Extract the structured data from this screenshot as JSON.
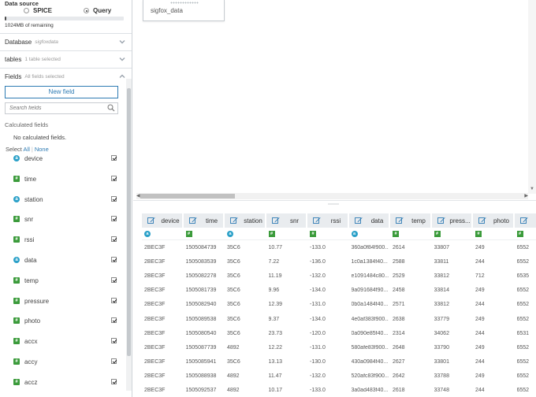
{
  "data_source": {
    "title": "Data source",
    "options": [
      {
        "label": "SPICE",
        "selected": false
      },
      {
        "label": "Query",
        "selected": true
      }
    ],
    "spice_used_fraction": 0.01,
    "remaining_text": "1024MB of remaining"
  },
  "database": {
    "label": "Database",
    "value": "sigfoxdata"
  },
  "tables": {
    "label": "tables",
    "value": "1 table selected"
  },
  "fields": {
    "label": "Fields",
    "value": "All fields selected",
    "new_field_label": "New field",
    "search_placeholder": "Search fields",
    "calculated_title": "Calculated fields",
    "no_calculated": "No calculated fields.",
    "select_label": "Select",
    "select_all": "All",
    "select_none": "None",
    "items": [
      {
        "name": "device",
        "type": "string",
        "icon": "a",
        "checked": true
      },
      {
        "name": "time",
        "type": "integer",
        "icon": "#",
        "checked": true
      },
      {
        "name": "station",
        "type": "string",
        "icon": "a",
        "checked": true
      },
      {
        "name": "snr",
        "type": "decimal",
        "icon": "#",
        "checked": true
      },
      {
        "name": "rssi",
        "type": "decimal",
        "icon": "#",
        "checked": true
      },
      {
        "name": "data",
        "type": "string",
        "icon": "a",
        "checked": true
      },
      {
        "name": "temp",
        "type": "integer",
        "icon": "#",
        "checked": true
      },
      {
        "name": "pressure",
        "type": "integer",
        "icon": "#",
        "checked": true
      },
      {
        "name": "photo",
        "type": "integer",
        "icon": "#",
        "checked": true
      },
      {
        "name": "accx",
        "type": "integer",
        "icon": "#",
        "checked": true
      },
      {
        "name": "accy",
        "type": "integer",
        "icon": "#",
        "checked": true
      },
      {
        "name": "accz",
        "type": "integer",
        "icon": "#",
        "checked": true
      }
    ]
  },
  "canvas": {
    "table_name": "sigfox_data"
  },
  "preview": {
    "columns": [
      {
        "name": "device",
        "type": "string",
        "icon": "a"
      },
      {
        "name": "time",
        "type": "integer",
        "icon": "#"
      },
      {
        "name": "station",
        "type": "string",
        "icon": "a"
      },
      {
        "name": "snr",
        "type": "decimal",
        "icon": "#"
      },
      {
        "name": "rssi",
        "type": "decimal",
        "icon": "#"
      },
      {
        "name": "data",
        "type": "string",
        "icon": "a"
      },
      {
        "name": "temp",
        "type": "integer",
        "icon": "#"
      },
      {
        "name": "press...",
        "type": "integer",
        "icon": "#"
      },
      {
        "name": "photo",
        "type": "integer",
        "icon": "#"
      },
      {
        "name": "",
        "type": "integer",
        "icon": "#"
      }
    ],
    "rows": [
      [
        "2BEC3F",
        "1505084739",
        "35C6",
        "10.77",
        "-133.0",
        "360a0f84f900...",
        "2614",
        "33807",
        "249",
        "6552"
      ],
      [
        "2BEC3F",
        "1505083539",
        "35C6",
        "7.22",
        "-136.0",
        "1c0a1384f40...",
        "2588",
        "33811",
        "244",
        "6552"
      ],
      [
        "2BEC3F",
        "1505082278",
        "35C6",
        "11.19",
        "-132.0",
        "e1091484c80...",
        "2529",
        "33812",
        "712",
        "6535"
      ],
      [
        "2BEC3F",
        "1505081739",
        "35C6",
        "9.96",
        "-134.0",
        "9a091684f90...",
        "2458",
        "33814",
        "249",
        "6552"
      ],
      [
        "2BEC3F",
        "1505082940",
        "35C6",
        "12.39",
        "-131.0",
        "0b0a1484f40...",
        "2571",
        "33812",
        "244",
        "6552"
      ],
      [
        "2BEC3F",
        "1505089538",
        "35C6",
        "9.37",
        "-134.0",
        "4e0af383f900...",
        "2638",
        "33779",
        "249",
        "6552"
      ],
      [
        "2BEC3F",
        "1505080540",
        "35C6",
        "23.73",
        "-120.0",
        "0a090e85f40...",
        "2314",
        "34062",
        "244",
        "6531"
      ],
      [
        "2BEC3F",
        "1505087739",
        "4892",
        "12.22",
        "-131.0",
        "580afe83f900...",
        "2648",
        "33790",
        "249",
        "6552"
      ],
      [
        "2BEC3F",
        "1505085941",
        "35C6",
        "13.13",
        "-130.0",
        "430a0984f40...",
        "2627",
        "33801",
        "244",
        "6552"
      ],
      [
        "2BEC3F",
        "1505088938",
        "4892",
        "11.47",
        "-132.0",
        "520afc83f900...",
        "2642",
        "33788",
        "249",
        "6552"
      ],
      [
        "2BEC3F",
        "1505092537",
        "4892",
        "10.17",
        "-133.0",
        "3a0ad483f40...",
        "2618",
        "33748",
        "244",
        "6552"
      ]
    ]
  },
  "colors": {
    "accent": "#2e7bb3",
    "string_icon": "#2aa0c8",
    "number_icon": "#3b9b3b"
  }
}
